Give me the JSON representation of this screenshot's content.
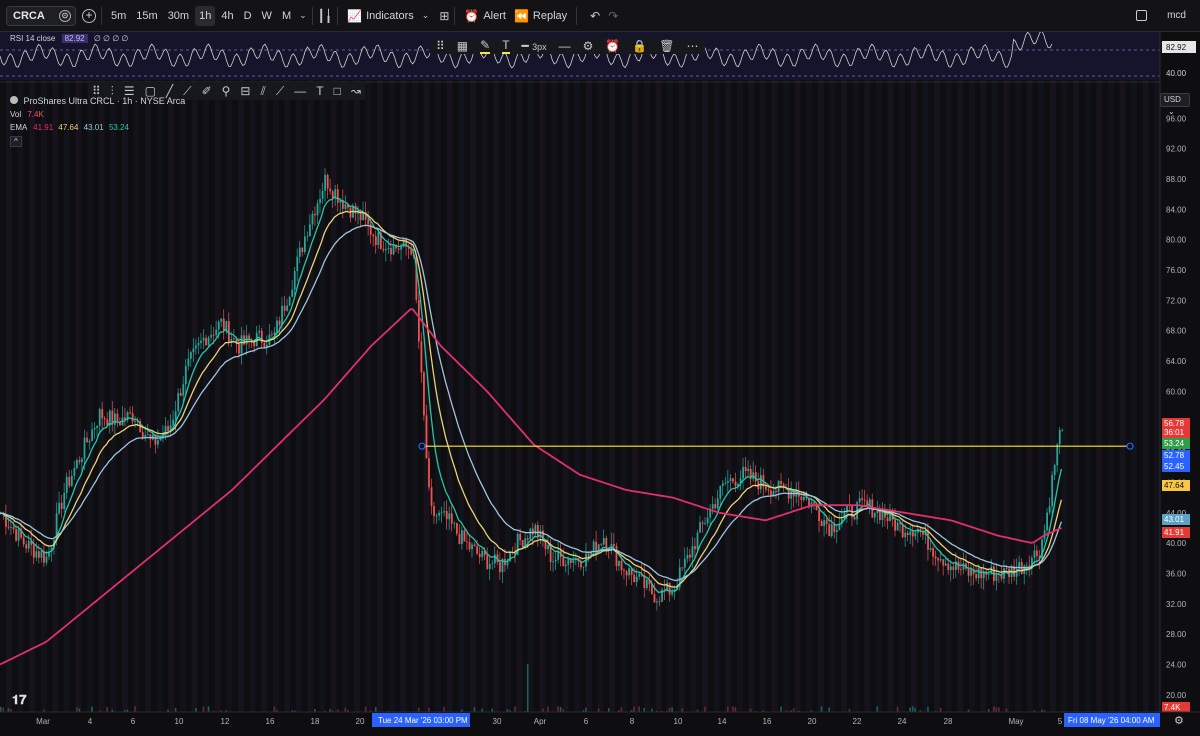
{
  "toolbar": {
    "symbol": "CRCA",
    "timeframes": [
      "5m",
      "15m",
      "30m",
      "1h",
      "4h",
      "D",
      "W",
      "M"
    ],
    "active_timeframe": "1h",
    "indicators_label": "Indicators",
    "alert_label": "Alert",
    "replay_label": "Replay",
    "user_label": "mcd"
  },
  "drawing_bar": {
    "width_label": "3px"
  },
  "rsi": {
    "label": "RSI 14 close",
    "value": "82.92",
    "extras": "∅ ∅ ∅ ∅",
    "levels": [
      "82.92",
      "40.00"
    ]
  },
  "legend": {
    "name": "ProShares Ultra CRCL · 1h · NYSE Arca",
    "vol_label": "Vol",
    "vol_value": "7.4K",
    "ema_label": "EMA",
    "ema_values": [
      "41.91",
      "47.64",
      "43.01",
      "53.24"
    ],
    "collapse": "^"
  },
  "currency": "USD",
  "colors": {
    "background": "#0e0e10",
    "ema_fast": "#26c6a6",
    "ema_mid": "#e8d27c",
    "ema_slow": "#9ec5dc",
    "ema_long": "#e0306b",
    "up": "#26a69a",
    "down": "#ef5350",
    "hline": "#f5e642",
    "highlight_date": "#2962ff"
  },
  "chart_data": {
    "type": "candlestick",
    "ylim": [
      18,
      100
    ],
    "y_ticks": [
      "96.00",
      "92.00",
      "88.00",
      "84.00",
      "80.00",
      "76.00",
      "72.00",
      "68.00",
      "64.00",
      "60.00",
      "56.00",
      "52.00",
      "48.00",
      "44.00",
      "40.00",
      "36.00",
      "32.00",
      "28.00",
      "24.00",
      "20.00"
    ],
    "x_ticks": [
      "Mar",
      "4",
      "6",
      "10",
      "12",
      "16",
      "18",
      "20",
      "24",
      "30",
      "Apr",
      "6",
      "8",
      "10",
      "14",
      "16",
      "20",
      "22",
      "24",
      "28",
      "May",
      "5"
    ],
    "x_highlight_left": "Tue 24 Mar '26   03:00 PM",
    "x_highlight_right": "Fri 08 May '26   04:00 AM",
    "horizontal_line": 52.78,
    "price_labels": [
      {
        "value": "56.78",
        "sub": "36:01",
        "color": "#e53935"
      },
      {
        "value": "53.24",
        "color": "#2e9e48"
      },
      {
        "value": "52.78",
        "color": "#2962ff"
      },
      {
        "value": "52.45",
        "color": "#2962ff"
      },
      {
        "value": "47.64",
        "color": "#f9c642"
      },
      {
        "value": "43.01",
        "color": "#5aa2c8"
      },
      {
        "value": "41.91",
        "color": "#e53935"
      },
      {
        "value": "7.4K",
        "color": "#e53935"
      }
    ],
    "close_path": [
      [
        0,
        44
      ],
      [
        0.02,
        40
      ],
      [
        0.04,
        38
      ],
      [
        0.055,
        47
      ],
      [
        0.07,
        52
      ],
      [
        0.085,
        57
      ],
      [
        0.1,
        56
      ],
      [
        0.115,
        57
      ],
      [
        0.13,
        53
      ],
      [
        0.145,
        55
      ],
      [
        0.16,
        63
      ],
      [
        0.175,
        67
      ],
      [
        0.19,
        69
      ],
      [
        0.205,
        66
      ],
      [
        0.22,
        67
      ],
      [
        0.235,
        67
      ],
      [
        0.25,
        74
      ],
      [
        0.265,
        82
      ],
      [
        0.28,
        88
      ],
      [
        0.295,
        85
      ],
      [
        0.31,
        83
      ],
      [
        0.325,
        80
      ],
      [
        0.34,
        79
      ],
      [
        0.355,
        79
      ],
      [
        0.37,
        44
      ],
      [
        0.385,
        43
      ],
      [
        0.4,
        40
      ],
      [
        0.415,
        38
      ],
      [
        0.43,
        37
      ],
      [
        0.445,
        40
      ],
      [
        0.46,
        42
      ],
      [
        0.475,
        38
      ],
      [
        0.49,
        38
      ],
      [
        0.505,
        38
      ],
      [
        0.52,
        41
      ],
      [
        0.535,
        37
      ],
      [
        0.55,
        35
      ],
      [
        0.565,
        33
      ],
      [
        0.58,
        34
      ],
      [
        0.595,
        39
      ],
      [
        0.61,
        44
      ],
      [
        0.625,
        48
      ],
      [
        0.64,
        49
      ],
      [
        0.655,
        48
      ],
      [
        0.67,
        47
      ],
      [
        0.685,
        47
      ],
      [
        0.7,
        45
      ],
      [
        0.715,
        42
      ],
      [
        0.73,
        44
      ],
      [
        0.745,
        45
      ],
      [
        0.76,
        44
      ],
      [
        0.775,
        42
      ],
      [
        0.79,
        42
      ],
      [
        0.805,
        39
      ],
      [
        0.82,
        37
      ],
      [
        0.835,
        36
      ],
      [
        0.85,
        36
      ],
      [
        0.865,
        36
      ],
      [
        0.88,
        37
      ],
      [
        0.895,
        39
      ],
      [
        0.9,
        42
      ],
      [
        0.905,
        47
      ],
      [
        0.91,
        52
      ],
      [
        0.915,
        56
      ]
    ],
    "ema_long_path": [
      [
        0,
        24
      ],
      [
        0.04,
        27
      ],
      [
        0.08,
        32
      ],
      [
        0.12,
        37
      ],
      [
        0.16,
        42
      ],
      [
        0.2,
        47
      ],
      [
        0.24,
        53
      ],
      [
        0.28,
        59
      ],
      [
        0.32,
        66
      ],
      [
        0.355,
        71
      ],
      [
        0.38,
        66
      ],
      [
        0.42,
        60
      ],
      [
        0.46,
        53
      ],
      [
        0.5,
        49
      ],
      [
        0.54,
        47
      ],
      [
        0.58,
        46
      ],
      [
        0.62,
        44
      ],
      [
        0.66,
        43
      ],
      [
        0.7,
        45
      ],
      [
        0.74,
        45
      ],
      [
        0.78,
        44
      ],
      [
        0.82,
        43
      ],
      [
        0.86,
        41
      ],
      [
        0.89,
        40
      ],
      [
        0.9,
        41
      ],
      [
        0.915,
        42
      ]
    ]
  }
}
